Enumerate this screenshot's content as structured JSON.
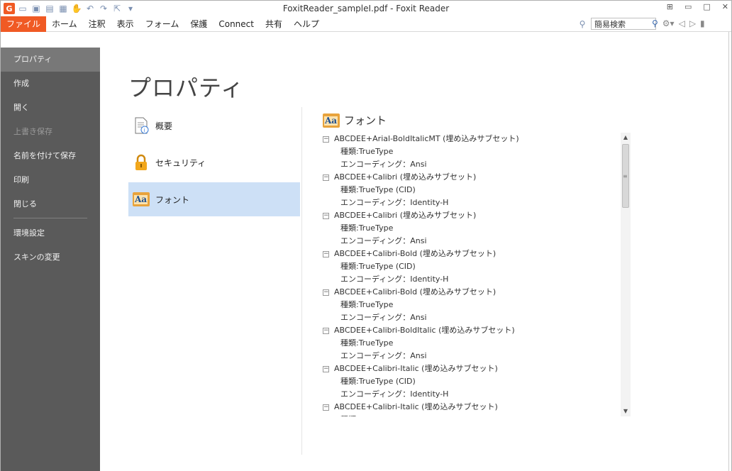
{
  "window": {
    "title": "FoxitReader_sampleI.pdf - Foxit Reader"
  },
  "qat": {
    "logo": "G",
    "icons": [
      "open-icon",
      "save-icon",
      "print-icon",
      "view-icon",
      "hand-icon",
      "undo-icon",
      "redo-icon",
      "select-icon",
      "more-icon"
    ]
  },
  "window_controls": {
    "minimize": "▭",
    "restore": "□",
    "close": "✕",
    "ribbon": "⊞"
  },
  "menu": [
    "ファイル",
    "ホーム",
    "注釈",
    "表示",
    "フォーム",
    "保護",
    "Connect",
    "共有",
    "ヘルプ"
  ],
  "search": {
    "value": "簡易検索"
  },
  "sidebar": {
    "items": [
      {
        "label": "プロパティ"
      },
      {
        "label": "作成"
      },
      {
        "label": "開く"
      },
      {
        "label": "上書き保存"
      },
      {
        "label": "名前を付けて保存"
      },
      {
        "label": "印刷"
      },
      {
        "label": "閉じる"
      }
    ],
    "items2": [
      {
        "label": "環境設定"
      },
      {
        "label": "スキンの変更"
      }
    ]
  },
  "page": {
    "title": "プロパティ"
  },
  "categories": [
    {
      "label": "概要"
    },
    {
      "label": "セキュリティ"
    },
    {
      "label": "フォント"
    }
  ],
  "fonts_panel": {
    "heading": "フォント",
    "icon_text": "Aa",
    "fonts": [
      {
        "name": "ABCDEE+Arial-BoldItalicMT (埋め込みサブセット)",
        "type": "種類:TrueType",
        "encoding": "エンコーディング：Ansi"
      },
      {
        "name": "ABCDEE+Calibri (埋め込みサブセット)",
        "type": "種類:TrueType (CID)",
        "encoding": "エンコーディング：Identity-H"
      },
      {
        "name": "ABCDEE+Calibri (埋め込みサブセット)",
        "type": "種類:TrueType",
        "encoding": "エンコーディング：Ansi"
      },
      {
        "name": "ABCDEE+Calibri-Bold (埋め込みサブセット)",
        "type": "種類:TrueType (CID)",
        "encoding": "エンコーディング：Identity-H"
      },
      {
        "name": "ABCDEE+Calibri-Bold (埋め込みサブセット)",
        "type": "種類:TrueType",
        "encoding": "エンコーディング：Ansi"
      },
      {
        "name": "ABCDEE+Calibri-BoldItalic (埋め込みサブセット)",
        "type": "種類:TrueType",
        "encoding": "エンコーディング：Ansi"
      },
      {
        "name": "ABCDEE+Calibri-Italic (埋め込みサブセット)",
        "type": "種類:TrueType (CID)",
        "encoding": "エンコーディング：Identity-H"
      },
      {
        "name": "ABCDEE+Calibri-Italic (埋め込みサブセット)",
        "type": "種類:TrueType",
        "encoding": ""
      }
    ]
  },
  "colors": {
    "accent": "#f05a24",
    "sidebar": "#5a5a5a",
    "selection": "#cde0f6"
  }
}
